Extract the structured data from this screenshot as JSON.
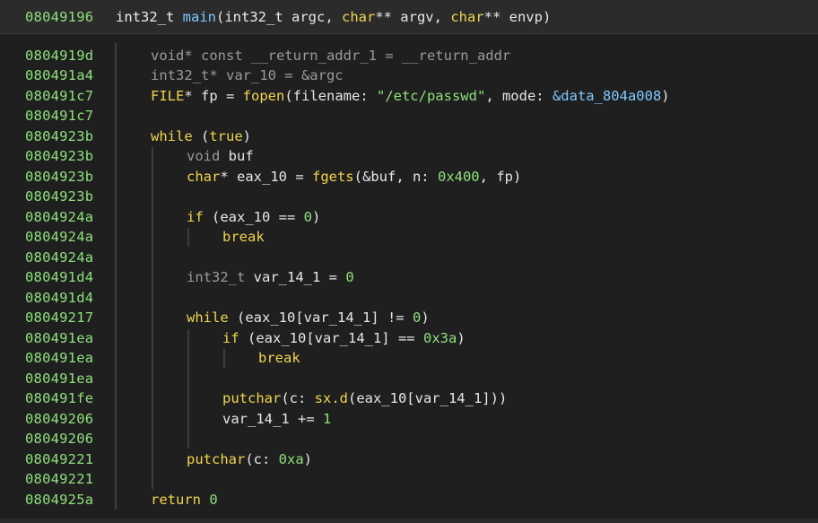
{
  "header": {
    "address": "08049196",
    "signature": [
      {
        "t": "int32_t ",
        "c": "t-type"
      },
      {
        "t": "main",
        "c": "t-fn-main"
      },
      {
        "t": "(",
        "c": "t-punct"
      },
      {
        "t": "int32_t",
        "c": "t-type"
      },
      {
        "t": " argc, ",
        "c": "t-ident"
      },
      {
        "t": "char",
        "c": "t-kw"
      },
      {
        "t": "** argv, ",
        "c": "t-ident"
      },
      {
        "t": "char",
        "c": "t-kw"
      },
      {
        "t": "** envp)",
        "c": "t-ident"
      }
    ]
  },
  "colors": {
    "address": "#8ee07c",
    "keyword": "#f0d44e",
    "number": "#8ee07c",
    "string": "#8ee07c",
    "data_ref": "#7fc9ff",
    "background": "#1f1f1f",
    "header_background": "#2b2b2b"
  },
  "lines": [
    {
      "addr": "0804919d",
      "indent": 1,
      "tokens": [
        {
          "t": "void* const __return_addr_1 = __return_addr",
          "c": "t-dim"
        }
      ]
    },
    {
      "addr": "080491a4",
      "indent": 1,
      "tokens": [
        {
          "t": "int32_t* var_10 = &argc",
          "c": "t-dim"
        }
      ]
    },
    {
      "addr": "080491c7",
      "indent": 1,
      "tokens": [
        {
          "t": "FILE",
          "c": "t-kw"
        },
        {
          "t": "* fp = ",
          "c": "t-ident"
        },
        {
          "t": "fopen",
          "c": "t-func"
        },
        {
          "t": "(filename: ",
          "c": "t-ident"
        },
        {
          "t": "\"/etc/passwd\"",
          "c": "t-str"
        },
        {
          "t": ", mode: ",
          "c": "t-ident"
        },
        {
          "t": "&data_804a008",
          "c": "t-data"
        },
        {
          "t": ")",
          "c": "t-ident"
        }
      ]
    },
    {
      "addr": "080491c7",
      "indent": 1,
      "tokens": []
    },
    {
      "addr": "0804923b",
      "indent": 1,
      "tokens": [
        {
          "t": "while",
          "c": "t-kw"
        },
        {
          "t": " (",
          "c": "t-ident"
        },
        {
          "t": "true",
          "c": "t-kw"
        },
        {
          "t": ")",
          "c": "t-ident"
        }
      ]
    },
    {
      "addr": "0804923b",
      "indent": 2,
      "tokens": [
        {
          "t": "void",
          "c": "t-dim"
        },
        {
          "t": " buf",
          "c": "t-ident"
        }
      ]
    },
    {
      "addr": "0804923b",
      "indent": 2,
      "tokens": [
        {
          "t": "char",
          "c": "t-kw"
        },
        {
          "t": "* eax_10 = ",
          "c": "t-ident"
        },
        {
          "t": "fgets",
          "c": "t-func"
        },
        {
          "t": "(&buf, n: ",
          "c": "t-ident"
        },
        {
          "t": "0x400",
          "c": "t-num"
        },
        {
          "t": ", fp)",
          "c": "t-ident"
        }
      ]
    },
    {
      "addr": "0804923b",
      "indent": 2,
      "tokens": []
    },
    {
      "addr": "0804924a",
      "indent": 2,
      "tokens": [
        {
          "t": "if",
          "c": "t-kw"
        },
        {
          "t": " (eax_10 == ",
          "c": "t-ident"
        },
        {
          "t": "0",
          "c": "t-num"
        },
        {
          "t": ")",
          "c": "t-ident"
        }
      ]
    },
    {
      "addr": "0804924a",
      "indent": 3,
      "tokens": [
        {
          "t": "break",
          "c": "t-kw"
        }
      ]
    },
    {
      "addr": "0804924a",
      "indent": 2,
      "tokens": []
    },
    {
      "addr": "080491d4",
      "indent": 2,
      "tokens": [
        {
          "t": "int32_t",
          "c": "t-dim"
        },
        {
          "t": " var_14_1 = ",
          "c": "t-ident"
        },
        {
          "t": "0",
          "c": "t-num"
        }
      ]
    },
    {
      "addr": "080491d4",
      "indent": 2,
      "tokens": []
    },
    {
      "addr": "08049217",
      "indent": 2,
      "tokens": [
        {
          "t": "while",
          "c": "t-kw"
        },
        {
          "t": " (eax_10[var_14_1] != ",
          "c": "t-ident"
        },
        {
          "t": "0",
          "c": "t-num"
        },
        {
          "t": ")",
          "c": "t-ident"
        }
      ]
    },
    {
      "addr": "080491ea",
      "indent": 3,
      "tokens": [
        {
          "t": "if",
          "c": "t-kw"
        },
        {
          "t": " (eax_10[var_14_1] == ",
          "c": "t-ident"
        },
        {
          "t": "0x3a",
          "c": "t-num"
        },
        {
          "t": ")",
          "c": "t-ident"
        }
      ]
    },
    {
      "addr": "080491ea",
      "indent": 4,
      "tokens": [
        {
          "t": "break",
          "c": "t-kw"
        }
      ]
    },
    {
      "addr": "080491ea",
      "indent": 3,
      "tokens": []
    },
    {
      "addr": "080491fe",
      "indent": 3,
      "tokens": [
        {
          "t": "putchar",
          "c": "t-func"
        },
        {
          "t": "(c: ",
          "c": "t-ident"
        },
        {
          "t": "sx.d",
          "c": "t-func"
        },
        {
          "t": "(eax_10[var_14_1]))",
          "c": "t-ident"
        }
      ]
    },
    {
      "addr": "08049206",
      "indent": 3,
      "tokens": [
        {
          "t": "var_14_1 += ",
          "c": "t-ident"
        },
        {
          "t": "1",
          "c": "t-num"
        }
      ]
    },
    {
      "addr": "08049206",
      "indent": 3,
      "tokens": []
    },
    {
      "addr": "08049221",
      "indent": 2,
      "tokens": [
        {
          "t": "putchar",
          "c": "t-func"
        },
        {
          "t": "(c: ",
          "c": "t-ident"
        },
        {
          "t": "0xa",
          "c": "t-num"
        },
        {
          "t": ")",
          "c": "t-ident"
        }
      ]
    },
    {
      "addr": "08049221",
      "indent": 2,
      "tokens": []
    },
    {
      "addr": "0804925a",
      "indent": 1,
      "tokens": [
        {
          "t": "return",
          "c": "t-kw"
        },
        {
          "t": " ",
          "c": "t-ident"
        },
        {
          "t": "0",
          "c": "t-num"
        }
      ]
    }
  ]
}
